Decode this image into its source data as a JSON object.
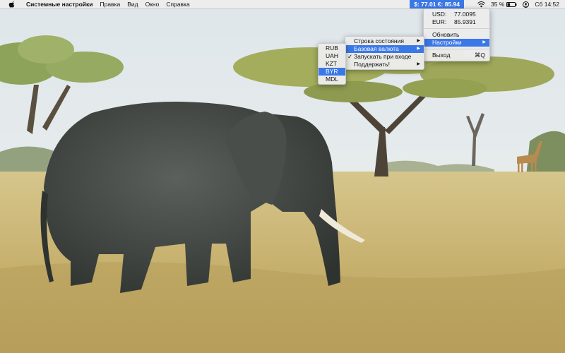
{
  "menubar": {
    "app_name": "Системные настройки",
    "items": [
      "Правка",
      "Вид",
      "Окно",
      "Справка"
    ],
    "rate_label": "$: 77.01 €: 85.94",
    "battery_percent": "35 %",
    "clock": "Сб 14:52"
  },
  "main_menu": {
    "rates": [
      {
        "currency": "USD:",
        "value": "77.0095"
      },
      {
        "currency": "EUR:",
        "value": "85.9391"
      }
    ],
    "refresh": "Обновить",
    "settings": "Настройки",
    "quit": "Выход",
    "quit_shortcut": "⌘Q"
  },
  "settings_menu": {
    "status_bar": "Строка состояния",
    "base_currency": "Базовая валюта",
    "launch_at_login": "Запускать при входе",
    "support": "Поддержать!"
  },
  "currency_menu": {
    "items": [
      "RUB",
      "UAH",
      "KZT",
      "BYR",
      "MDL"
    ],
    "highlighted": "BYR"
  },
  "colors": {
    "accent": "#3b78e7",
    "sky": "#e9eef1",
    "grass": "#c9b377"
  }
}
